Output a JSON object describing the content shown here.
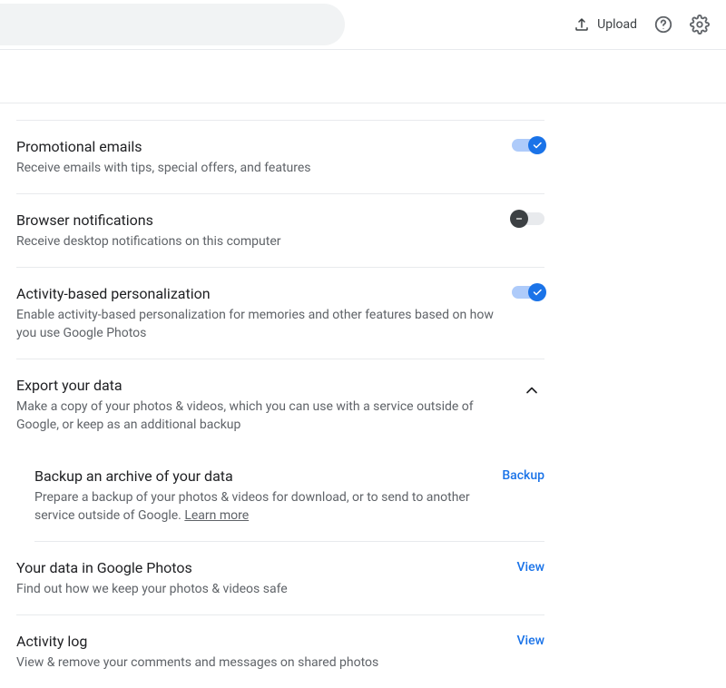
{
  "header": {
    "upload_label": "Upload"
  },
  "settings": {
    "promo": {
      "title": "Promotional emails",
      "desc": "Receive emails with tips, special offers, and features"
    },
    "browser_notif": {
      "title": "Browser notifications",
      "desc": "Receive desktop notifications on this computer"
    },
    "activity_pers": {
      "title": "Activity-based personalization",
      "desc": "Enable activity-based personalization for memories and other features based on how you use Google Photos"
    },
    "export": {
      "title": "Export your data",
      "desc": "Make a copy of your photos & videos, which you can use with a service outside of Google, or keep as an additional backup"
    },
    "backup_archive": {
      "title": "Backup an archive of your data",
      "desc_prefix": "Prepare a backup of your photos & videos for download, or to send to another service outside of Google. ",
      "learn_more": "Learn more",
      "action": "Backup"
    },
    "your_data": {
      "title": "Your data in Google Photos",
      "desc": "Find out how we keep your photos & videos safe",
      "action": "View"
    },
    "activity_log": {
      "title": "Activity log",
      "desc": "View & remove your comments and messages on shared photos",
      "action": "View"
    }
  }
}
